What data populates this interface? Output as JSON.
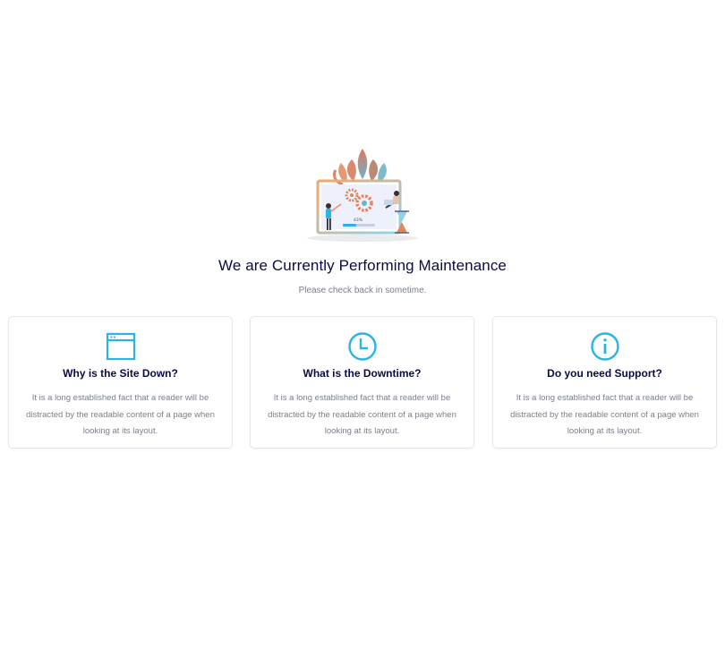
{
  "header": {
    "title": "We are Currently Performing Maintenance",
    "subtitle": "Please check back in sometime."
  },
  "illustration": {
    "icon": "maintenance-illustration",
    "progress_label": "43%"
  },
  "cards": [
    {
      "icon": "browser-window-icon",
      "title": "Why is the Site Down?",
      "text": "It is a long established fact that a reader will be distracted by the readable content of a page when looking at its layout."
    },
    {
      "icon": "clock-icon",
      "title": "What is the Downtime?",
      "text": "It is a long established fact that a reader will be distracted by the readable content of a page when looking at its layout."
    },
    {
      "icon": "info-icon",
      "title": "Do you need Support?",
      "text": "It is a long established fact that a reader will be distracted by the readable content of a page when looking at its layout."
    }
  ],
  "colors": {
    "accent": "#2bb3e6",
    "heading": "#0b0b45",
    "body_text": "#7a7f8e",
    "card_border": "#e4e6ed"
  }
}
